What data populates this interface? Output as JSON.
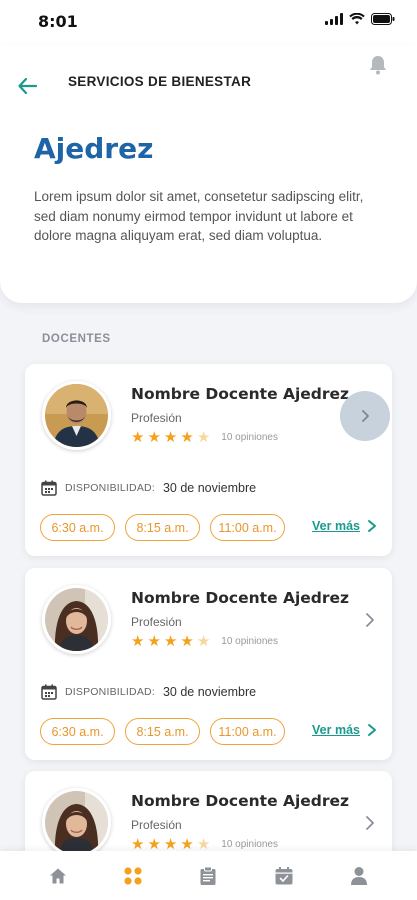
{
  "status_bar": {
    "time": "8:01"
  },
  "header": {
    "nav_title": "SERVICIOS DE BIENESTAR",
    "title": "Ajedrez",
    "description": "Lorem ipsum dolor sit amet, consetetur sadipscing elitr, sed diam nonumy eirmod tempor invidunt ut labore et dolore magna aliquyam erat, sed diam voluptua."
  },
  "section_label": "DOCENTES",
  "teachers": [
    {
      "name": "Nombre Docente Ajedrez",
      "profession": "Profesión",
      "rating": 4,
      "opinions": "10 opiniones",
      "availability_label": "DISPONIBILIDAD:",
      "availability_date": "30 de noviembre",
      "slots": [
        "6:30 a.m.",
        "8:15 a.m.",
        "11:00 a.m."
      ],
      "more_label": "Ver más"
    },
    {
      "name": "Nombre Docente Ajedrez",
      "profession": "Profesión",
      "rating": 4,
      "opinions": "10 opiniones",
      "availability_label": "DISPONIBILIDAD:",
      "availability_date": "30 de noviembre",
      "slots": [
        "6:30 a.m.",
        "8:15 a.m.",
        "11:00 a.m."
      ],
      "more_label": "Ver más"
    },
    {
      "name": "Nombre Docente Ajedrez",
      "profession": "Profesión",
      "rating": 4,
      "opinions": "10 opiniones"
    }
  ],
  "colors": {
    "title_blue": "#1f64a6",
    "accent_teal": "#1a9a8e",
    "slot_orange": "#e8962b",
    "star": "#f3a11e",
    "nav_active": "#f3a11e"
  },
  "bottom_nav": [
    {
      "icon": "home-icon",
      "active": false
    },
    {
      "icon": "grid-icon",
      "active": true
    },
    {
      "icon": "clipboard-icon",
      "active": false
    },
    {
      "icon": "calendar-check-icon",
      "active": false
    },
    {
      "icon": "user-icon",
      "active": false
    }
  ]
}
